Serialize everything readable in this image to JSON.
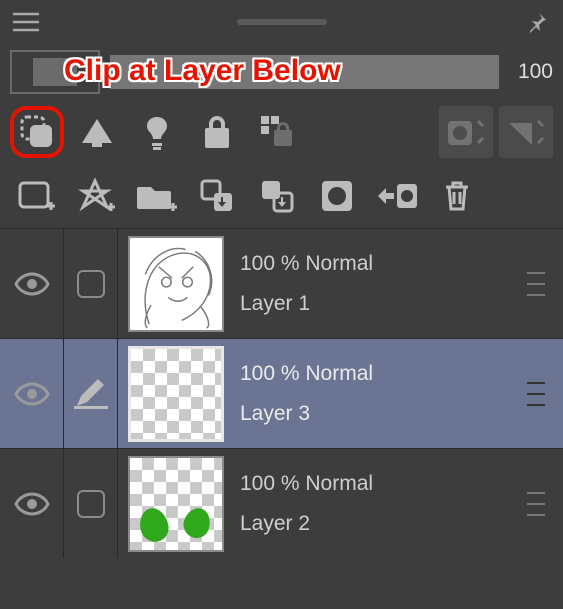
{
  "callout": "Clip at Layer Below",
  "opacity": {
    "value": "100"
  },
  "icons": {
    "menu": "menu-icon",
    "pin": "pin-icon",
    "clip": "clip-at-layer-below-icon",
    "ref": "set-as-reference-layer-icon",
    "draft": "set-as-draft-layer-icon",
    "lock": "lock-icon",
    "lock_alpha": "lock-transparent-pixels-icon",
    "mask_enable": "enable-mask-icon",
    "mask_apply": "apply-mask-icon",
    "new_raster": "new-raster-layer-icon",
    "new_vector": "new-vector-layer-icon",
    "new_folder": "new-folder-icon",
    "transfer_down": "transfer-to-lower-layer-icon",
    "merge_down": "merge-with-lower-layer-icon",
    "new_mask": "create-layer-mask-icon",
    "mask_from_canvas": "apply-mask-to-layer-icon",
    "delete": "delete-layer-icon"
  },
  "layers": [
    {
      "blend": "100 % Normal",
      "name": "Layer 1",
      "selected": false,
      "editing": false,
      "thumb": "drawing"
    },
    {
      "blend": "100 % Normal",
      "name": "Layer 3",
      "selected": true,
      "editing": true,
      "thumb": "empty"
    },
    {
      "blend": "100 % Normal",
      "name": "Layer 2",
      "selected": false,
      "editing": false,
      "thumb": "green-blobs"
    }
  ]
}
